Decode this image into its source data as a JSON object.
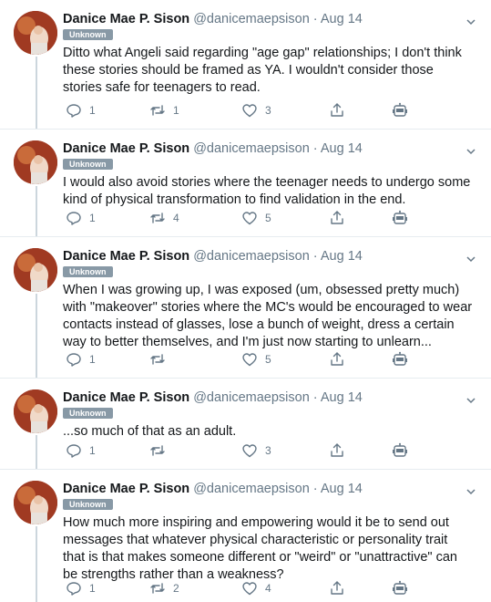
{
  "tweets": [
    {
      "name": "Danice Mae P. Sison",
      "handle": "@danicemaepsison",
      "dot": "·",
      "date": "Aug 14",
      "badge": "Unknown",
      "text": "Ditto what Angeli said regarding \"age gap\" relationships; I don't think these stories should be framed as YA. I wouldn't consider those stories safe for teenagers to read.",
      "replies": "1",
      "retweets": "1",
      "likes": "3"
    },
    {
      "name": "Danice Mae P. Sison",
      "handle": "@danicemaepsison",
      "dot": "·",
      "date": "Aug 14",
      "badge": "Unknown",
      "text": "I would also avoid stories where the teenager needs to undergo some kind of physical transformation to find validation in the end.",
      "replies": "1",
      "retweets": "4",
      "likes": "5"
    },
    {
      "name": "Danice Mae P. Sison",
      "handle": "@danicemaepsison",
      "dot": "·",
      "date": "Aug 14",
      "badge": "Unknown",
      "text": "When I was growing up, I was exposed (um, obsessed pretty much) with \"makeover\" stories where the MC's would be encouraged to wear contacts instead of glasses, lose a bunch of weight, dress a certain way to better themselves, and I'm just now starting to unlearn...",
      "replies": "1",
      "retweets": "",
      "likes": "5"
    },
    {
      "name": "Danice Mae P. Sison",
      "handle": "@danicemaepsison",
      "dot": "·",
      "date": "Aug 14",
      "badge": "Unknown",
      "text": "...so much of that as an adult.",
      "replies": "1",
      "retweets": "",
      "likes": "3"
    },
    {
      "name": "Danice Mae P. Sison",
      "handle": "@danicemaepsison",
      "dot": "·",
      "date": "Aug 14",
      "badge": "Unknown",
      "text": "How much more inspiring and empowering would it be to send out messages that whatever physical characteristic or personality trait that is that makes someone different or \"weird\" or \"unattractive\" can be strengths rather than a weakness?",
      "replies": "1",
      "retweets": "2",
      "likes": "4"
    }
  ],
  "icons": {
    "reply": "reply-icon",
    "retweet": "retweet-icon",
    "like": "heart-icon",
    "share": "share-icon",
    "bot": "bot-icon",
    "more": "chevron-down-icon"
  },
  "colors": {
    "secondary_text": "#657786",
    "badge_bg": "#8899a6",
    "thread_line": "#ccd6dd",
    "divider": "#e6ecf0"
  }
}
